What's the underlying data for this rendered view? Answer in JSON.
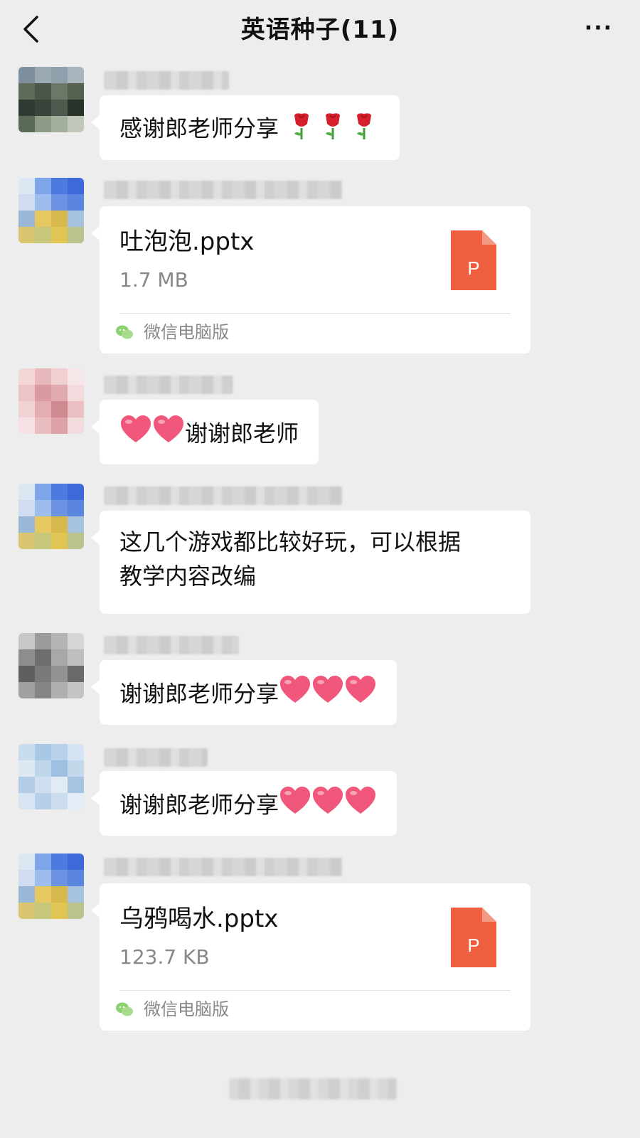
{
  "header": {
    "title": "英语种子(11)",
    "more_label": "···"
  },
  "messages": [
    {
      "type": "text",
      "text": "感谢郎老师分享",
      "emoji": "rose"
    },
    {
      "type": "file",
      "file_name": "吐泡泡.pptx",
      "file_size": "1.7 MB",
      "source": "微信电脑版",
      "file_icon": "P"
    },
    {
      "type": "text",
      "text": "谢谢郎老师",
      "emoji": "heart"
    },
    {
      "type": "text",
      "line1": "这几个游戏都比较好玩，可以根据",
      "line2": "教学内容改编"
    },
    {
      "type": "text",
      "text": "谢谢郎老师分享",
      "emoji": "heart"
    },
    {
      "type": "text",
      "text": "谢谢郎老师分享",
      "emoji": "heart"
    },
    {
      "type": "file",
      "file_name": "乌鸦喝水.pptx",
      "file_size": "123.7 KB",
      "source": "微信电脑版",
      "file_icon": "P"
    }
  ],
  "colors": {
    "background": "#ededed",
    "bubble": "#ffffff",
    "ppt_icon": "#ee5f3f",
    "heart": "#f0577a",
    "rose": "#d61f2c"
  }
}
